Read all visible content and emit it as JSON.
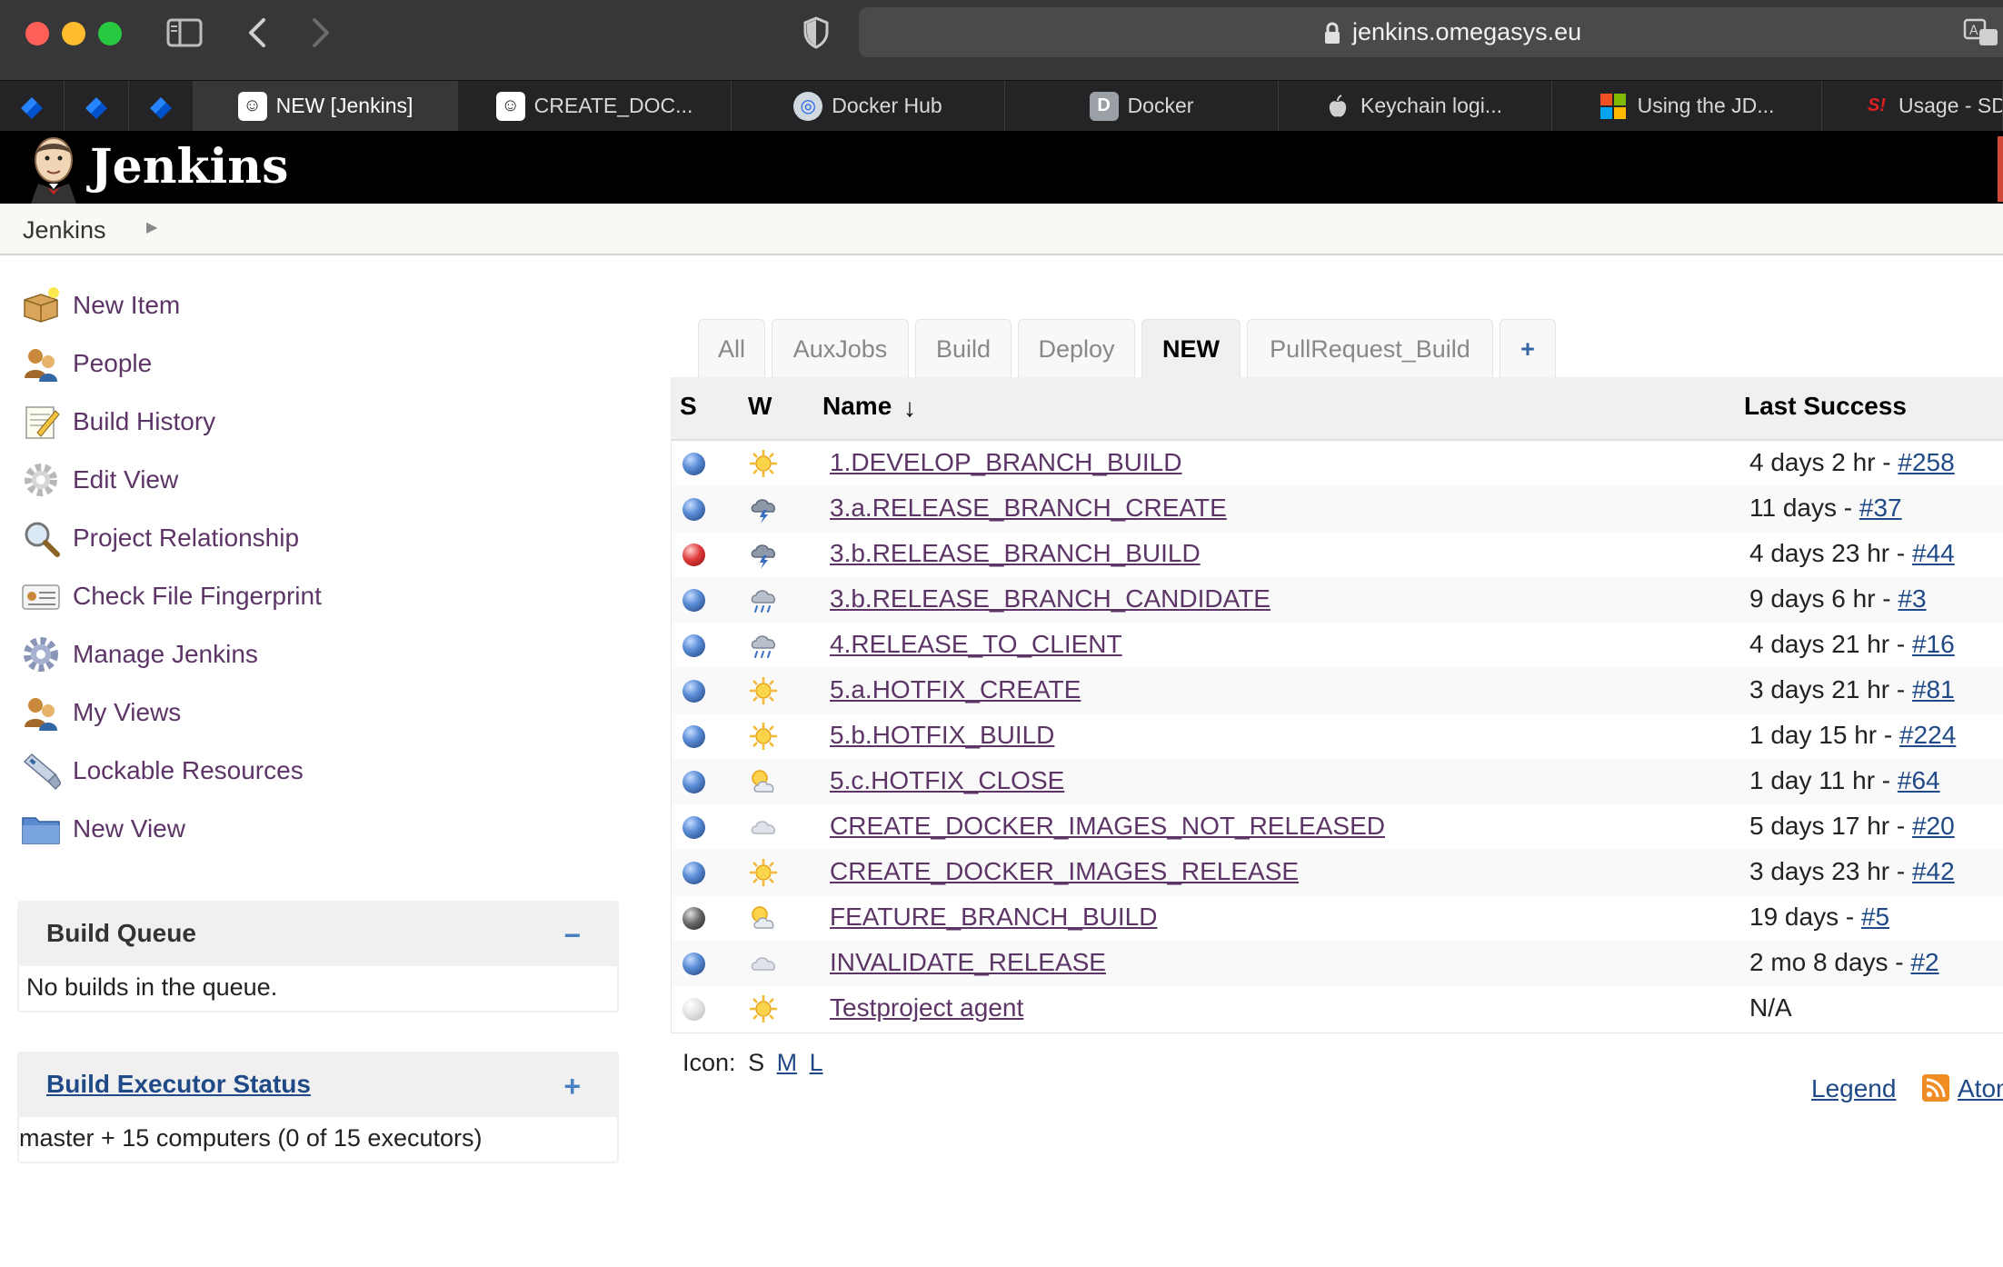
{
  "browser": {
    "url": "jenkins.omegasys.eu",
    "tabs": [
      {
        "label": "NEW [Jenkins]",
        "icon": "jenkins-icon"
      },
      {
        "label": "CREATE_DOC...",
        "icon": "jenkins-icon"
      },
      {
        "label": "Docker Hub",
        "icon": "docker-hub-icon"
      },
      {
        "label": "Docker",
        "icon": "docker-d-icon",
        "icon_letter": "D"
      },
      {
        "label": "Keychain logi...",
        "icon": "apple-icon"
      },
      {
        "label": "Using the JD...",
        "icon": "microsoft-icon"
      },
      {
        "label": "Usage - SD",
        "icon": "sdkman-icon"
      }
    ],
    "pinned_tabs": [
      "jira-icon",
      "jira-icon",
      "jira-icon"
    ]
  },
  "header": {
    "logo_text": "Jenkins"
  },
  "breadcrumb": {
    "root": "Jenkins"
  },
  "sidebar": {
    "tasks": [
      {
        "label": "New Item",
        "icon": "new-item-icon"
      },
      {
        "label": "People",
        "icon": "people-icon"
      },
      {
        "label": "Build History",
        "icon": "build-history-icon"
      },
      {
        "label": "Edit View",
        "icon": "gear-icon"
      },
      {
        "label": "Project Relationship",
        "icon": "search-icon"
      },
      {
        "label": "Check File Fingerprint",
        "icon": "fingerprint-icon"
      },
      {
        "label": "Manage Jenkins",
        "icon": "gear-icon"
      },
      {
        "label": "My Views",
        "icon": "people-icon"
      },
      {
        "label": "Lockable Resources",
        "icon": "usb-icon"
      },
      {
        "label": "New View",
        "icon": "folder-icon"
      }
    ]
  },
  "build_queue": {
    "title": "Build Queue",
    "toggle": "−",
    "message": "No builds in the queue."
  },
  "executor_status": {
    "title": "Build Executor Status",
    "toggle": "+",
    "message": "master + 15 computers (0 of 15 executors)"
  },
  "views": {
    "tabs": [
      "All",
      "AuxJobs",
      "Build",
      "Deploy",
      "NEW",
      "PullRequest_Build",
      "+"
    ],
    "active": "NEW"
  },
  "table": {
    "headers": {
      "status": "S",
      "weather": "W",
      "name": "Name",
      "sort_arrow": "↓",
      "last_success": "Last Success"
    },
    "jobs": [
      {
        "status": "blue",
        "weather": "sunny",
        "name": "1.DEVELOP_BRANCH_BUILD",
        "last": "4 days 2 hr - ",
        "build": "#258"
      },
      {
        "status": "blue",
        "weather": "thunderstorm",
        "name": "3.a.RELEASE_BRANCH_CREATE",
        "last": "11 days - ",
        "build": "#37"
      },
      {
        "status": "red",
        "weather": "thunderstorm",
        "name": "3.b.RELEASE_BRANCH_BUILD",
        "last": "4 days 23 hr - ",
        "build": "#44"
      },
      {
        "status": "blue",
        "weather": "rain",
        "name": "3.b.RELEASE_BRANCH_CANDIDATE",
        "last": "9 days 6 hr - ",
        "build": "#3"
      },
      {
        "status": "blue",
        "weather": "rain",
        "name": "4.RELEASE_TO_CLIENT",
        "last": "4 days 21 hr - ",
        "build": "#16"
      },
      {
        "status": "blue",
        "weather": "sunny",
        "name": "5.a.HOTFIX_CREATE",
        "last": "3 days 21 hr - ",
        "build": "#81"
      },
      {
        "status": "blue",
        "weather": "sunny",
        "name": "5.b.HOTFIX_BUILD",
        "last": "1 day 15 hr - ",
        "build": "#224"
      },
      {
        "status": "blue",
        "weather": "partly-cloudy",
        "name": "5.c.HOTFIX_CLOSE",
        "last": "1 day 11 hr - ",
        "build": "#64"
      },
      {
        "status": "blue",
        "weather": "cloudy",
        "name": "CREATE_DOCKER_IMAGES_NOT_RELEASED",
        "last": "5 days 17 hr - ",
        "build": "#20"
      },
      {
        "status": "blue",
        "weather": "sunny",
        "name": "CREATE_DOCKER_IMAGES_RELEASE",
        "last": "3 days 23 hr - ",
        "build": "#42"
      },
      {
        "status": "grey",
        "weather": "partly-cloudy",
        "name": "FEATURE_BRANCH_BUILD",
        "last": "19 days - ",
        "build": "#5"
      },
      {
        "status": "blue",
        "weather": "cloudy",
        "name": "INVALIDATE_RELEASE",
        "last": "2 mo 8 days - ",
        "build": "#2"
      },
      {
        "status": "disabled",
        "weather": "sunny",
        "name": "Testproject agent",
        "last": "N/A",
        "build": ""
      }
    ]
  },
  "footer": {
    "icon_label": "Icon:",
    "sizes": [
      "S",
      "M",
      "L"
    ],
    "legend": "Legend",
    "atom": "Atom"
  },
  "colors": {
    "link": "#5c3566",
    "build_link": "#204a87",
    "header_bg": "#000000",
    "chrome_bg": "#37373a"
  }
}
